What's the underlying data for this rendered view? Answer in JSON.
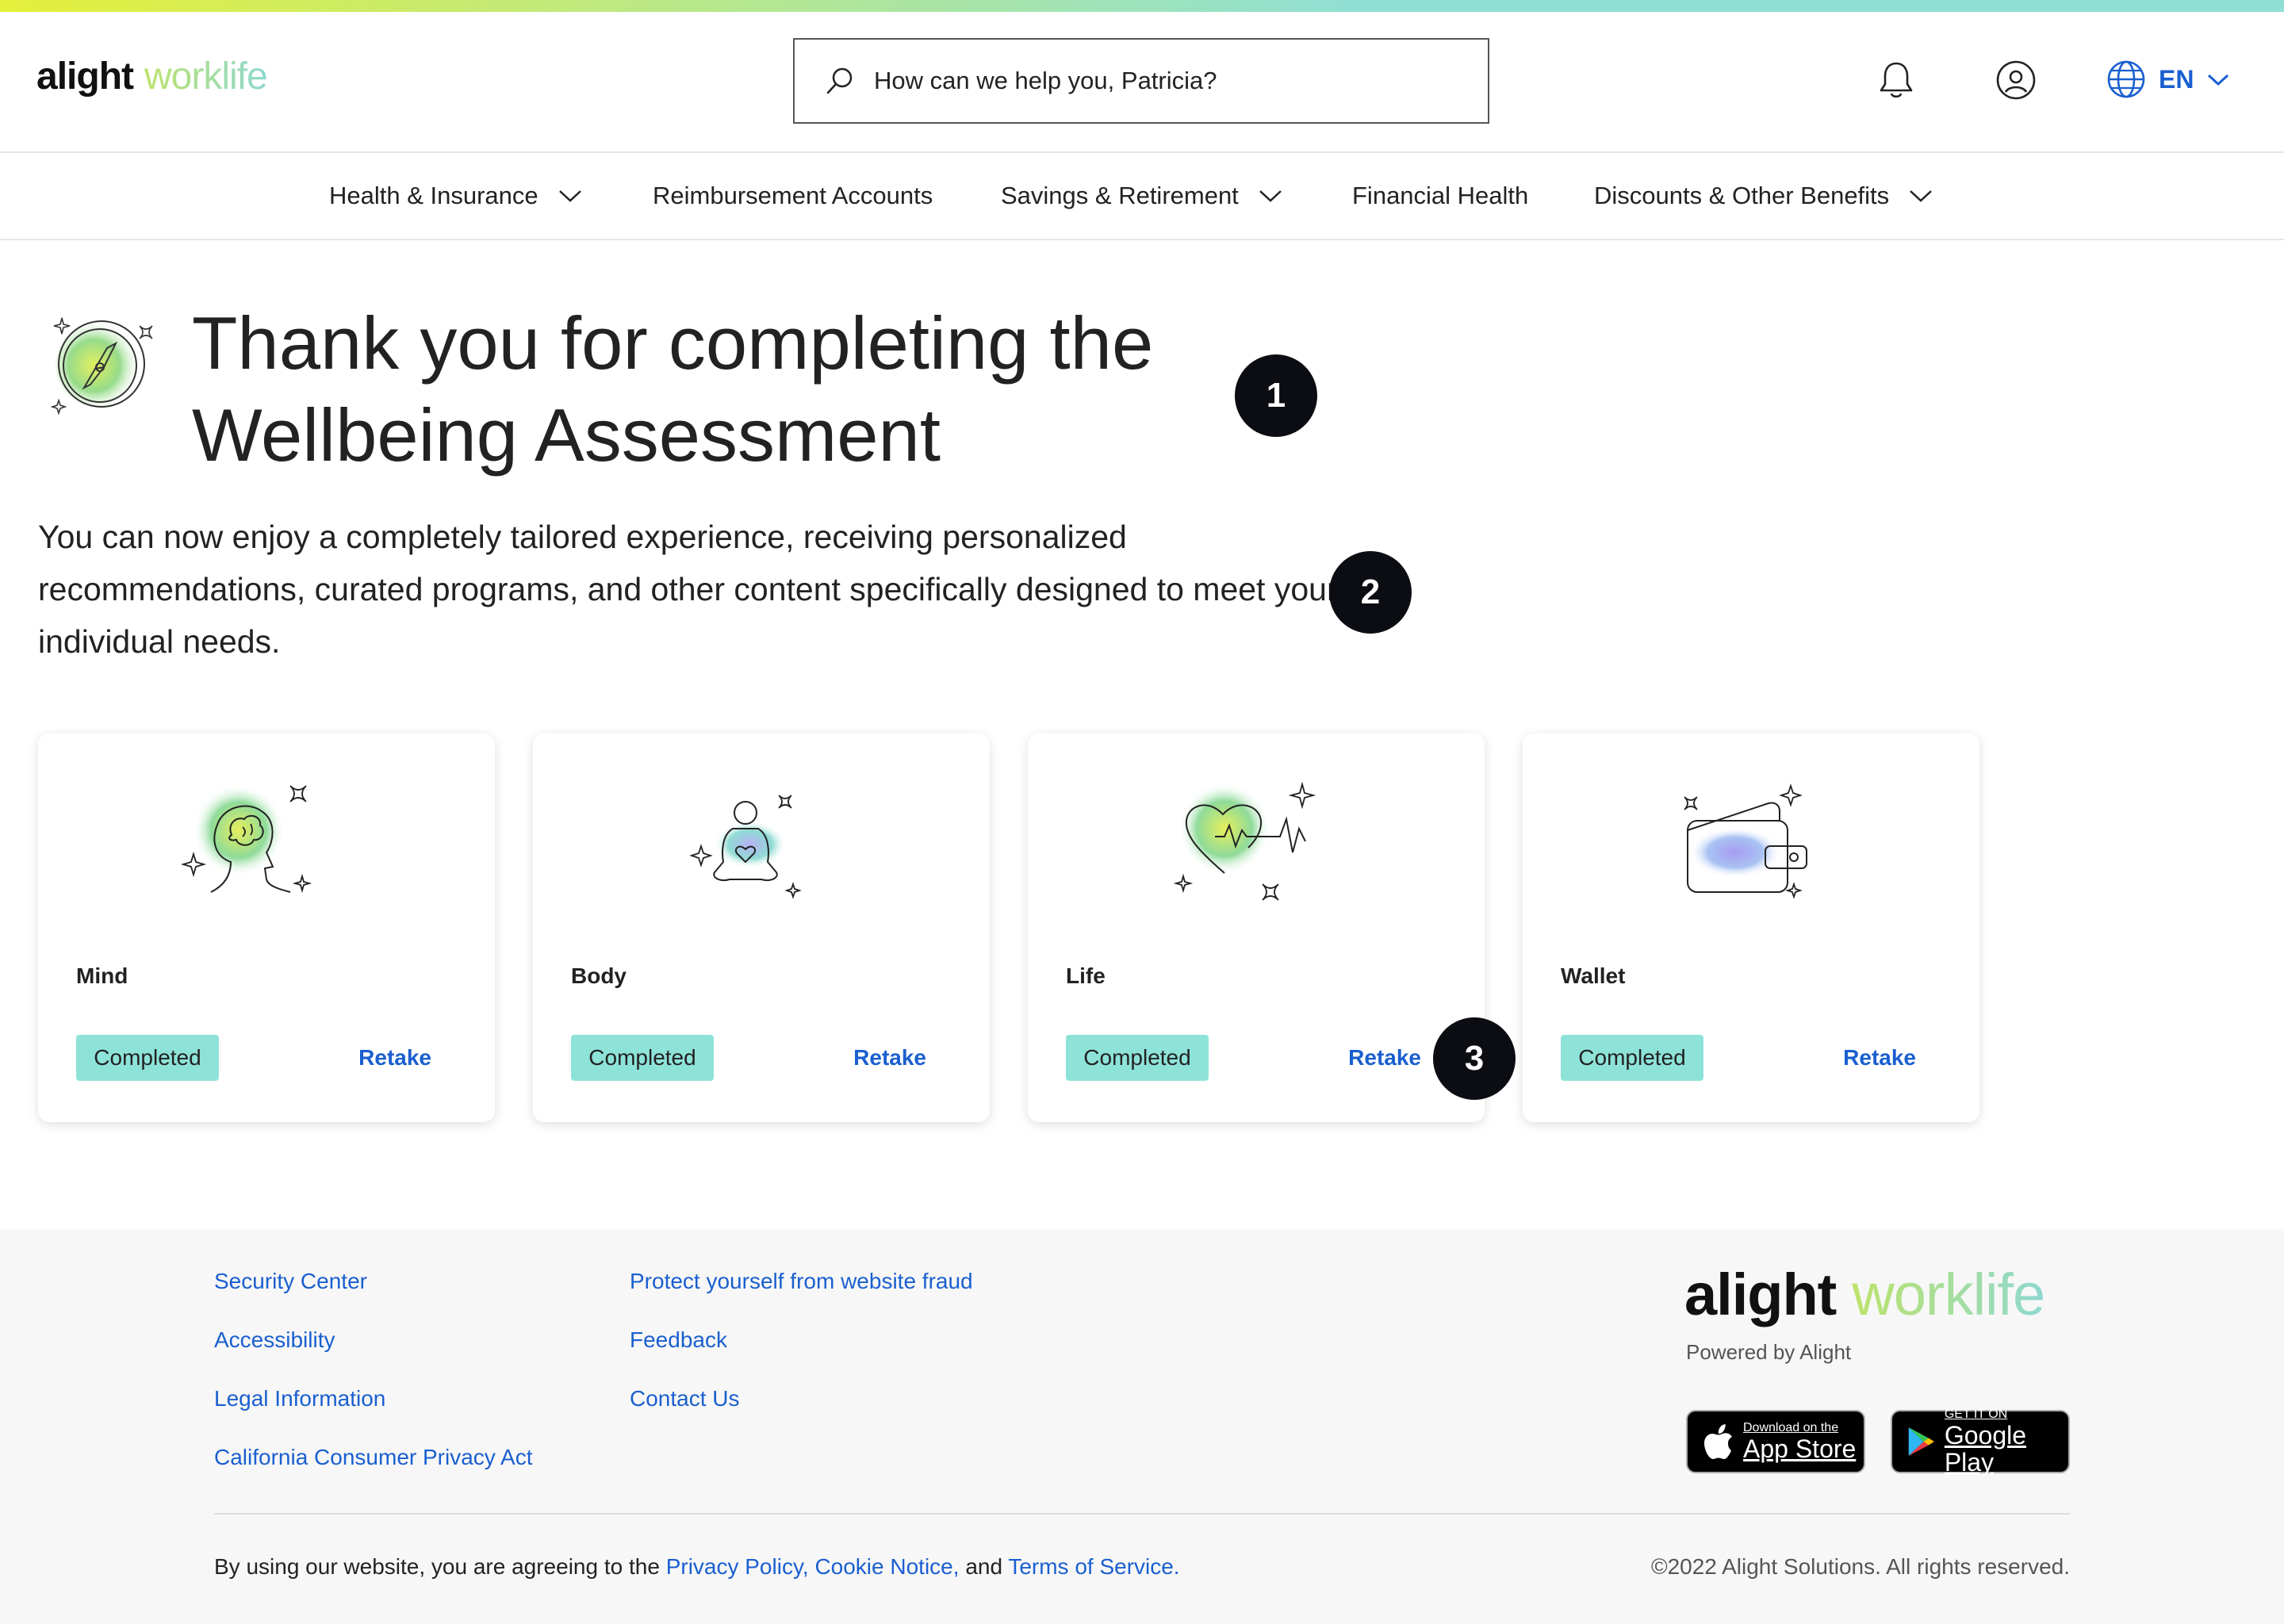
{
  "brand": {
    "logo_part1": "alight",
    "logo_part2": "worklife",
    "powered_by": "Powered by Alight"
  },
  "header": {
    "search_placeholder": "How can we help you, Patricia?",
    "language": "EN"
  },
  "nav": {
    "items": [
      {
        "label": "Health & Insurance",
        "has_dropdown": true
      },
      {
        "label": "Reimbursement Accounts",
        "has_dropdown": false
      },
      {
        "label": "Savings & Retirement",
        "has_dropdown": true
      },
      {
        "label": "Financial Health",
        "has_dropdown": false
      },
      {
        "label": "Discounts & Other Benefits",
        "has_dropdown": true
      }
    ]
  },
  "hero": {
    "title_line1": "Thank you for completing the",
    "title_line2": "Wellbeing Assessment",
    "intro": "You can now enjoy a completely tailored experience, receiving personalized recommendations, curated programs, and other content specifically designed to meet your individual needs."
  },
  "markers": [
    "1",
    "2",
    "3"
  ],
  "cards": [
    {
      "name": "Mind",
      "status": "Completed",
      "action": "Retake"
    },
    {
      "name": "Body",
      "status": "Completed",
      "action": "Retake"
    },
    {
      "name": "Life",
      "status": "Completed",
      "action": "Retake"
    },
    {
      "name": "Wallet",
      "status": "Completed",
      "action": "Retake"
    }
  ],
  "footer": {
    "links_col1": [
      "Security Center",
      "Accessibility",
      "Legal Information",
      "California Consumer Privacy Act"
    ],
    "links_col2": [
      "Protect yourself from website fraud",
      "Feedback",
      "Contact Us"
    ],
    "app_store": {
      "line1": "Download on the",
      "line2": "App Store"
    },
    "google_play": {
      "line1": "GET IT ON",
      "line2": "Google Play"
    },
    "legal_prefix": "By using our website, you are agreeing to the",
    "legal_links": [
      "Privacy Policy,",
      "Cookie Notice,",
      "Terms of Service."
    ],
    "legal_and": "and",
    "copyright": "©2022 Alight Solutions. All rights reserved."
  },
  "colors": {
    "accent_blue": "#1a5fd0",
    "badge_teal": "#8ee3d9",
    "marker_dark": "#0b0d12"
  }
}
